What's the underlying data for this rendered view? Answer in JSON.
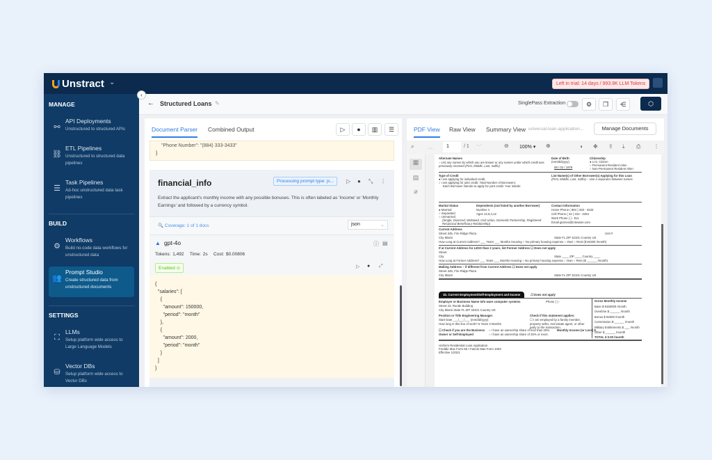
{
  "app": {
    "name": "Unstract",
    "trial": "Left in trial: 14 days / 993.9K LLM Tokens"
  },
  "sidebar": {
    "sections": [
      {
        "title": "MANAGE",
        "items": [
          {
            "label": "API Deployments",
            "desc": "Unstructured to structured APIs",
            "icon": "api-icon"
          },
          {
            "label": "ETL Pipelines",
            "desc": "Unstructured to structured data pipelines",
            "icon": "etl-icon"
          },
          {
            "label": "Task Pipelines",
            "desc": "Ad-hoc unstructured data task pipelines",
            "icon": "task-icon"
          }
        ]
      },
      {
        "title": "BUILD",
        "items": [
          {
            "label": "Workflows",
            "desc": "Build no-code data workflows for unstructured data",
            "icon": "workflow-icon"
          },
          {
            "label": "Prompt Studio",
            "desc": "Create structured data from unstructured documents",
            "icon": "prompt-studio-icon"
          }
        ]
      },
      {
        "title": "SETTINGS",
        "items": [
          {
            "label": "LLMs",
            "desc": "Setup platform wide access to Large Language Models",
            "icon": "llm-icon"
          },
          {
            "label": "Vector DBs",
            "desc": "Setup platform wide access to Vector DBs",
            "icon": "database-icon"
          }
        ]
      }
    ]
  },
  "header": {
    "title": "Structured Loans",
    "singlepass": "SinglePass Extraction"
  },
  "mid": {
    "tabs": [
      "Document Parser",
      "Combined Output"
    ],
    "prev_output": [
      "\"Phone Number\": \"(884) 333-3433\"",
      "}"
    ],
    "prompt": {
      "title": "financial_info",
      "status": "Processing prompt type: js...",
      "text": "Extract the applicant's monthly income with any possible bonuses. This is often labeled as 'Income' or 'Monthly Earnings' and followed by a currency symbol.",
      "coverage": "Coverage: 1 of 1 docs",
      "type": "json"
    },
    "llm": {
      "name": "gpt-4o",
      "tokens": "Tokens: 1,492",
      "time": "Time: 2s",
      "cost": "Cost: $0.00806",
      "enabled": "Enabled"
    },
    "output": [
      "{",
      "  \"salaries\": [",
      "    {",
      "      \"amount\": 150000,",
      "      \"period\": \"month\"",
      "    },",
      "    {",
      "      \"amount\": 2000,",
      "      \"period\": \"month\"",
      "    }",
      "  ]",
      "}"
    ]
  },
  "right": {
    "tabs": [
      "PDF View",
      "Raw View",
      "Summary View"
    ],
    "filename": "universal-loan-application...",
    "manage": "Manage Documents",
    "page": "1",
    "pages": "/ 1",
    "zoom": "100% ▾"
  },
  "pdf": {
    "alt_names": "Alternate Names",
    "alt_desc": "– List any names by which you are known or any names under which credit was previously received (First, Middle, Last, Suffix)",
    "dob": "Date of Birth",
    "dob_fmt": "(mm/dd/yyyy)",
    "dob_val": "08 / 02 / 1979",
    "citizenship": "Citizenship",
    "cit1": "U.S. Citizen",
    "cit2": "Permanent Resident Alien",
    "cit3": "Non-Permanent Resident Alien",
    "type_credit": "Type of Credit",
    "tc1": "I am applying for individual credit.",
    "tc2": "I am applying for joint credit. Total Number of Borrowers:",
    "tc3": "Each Borrower intends to apply for joint credit. Your initials:",
    "other_borrowers": "List Name(s) of Other Borrower(s) Applying for this Loan",
    "other_desc": "(First, Middle, Last, Suffix) – Use a separator between names",
    "marital": "Marital Status",
    "m1": "Married",
    "m2": "Separated",
    "m3": "Unmarried",
    "m_desc": "(Single, Divorced, Widowed, Civil Union, Domestic Partnership, Registered Reciprocal Beneficiary Relationship)",
    "dependents": "Dependents (not listed by another Borrower)",
    "dep_num": "Number  4",
    "dep_ages": "Ages 12,8,4,12",
    "contact": "Contact Information",
    "home": "Home Phone  ( 884 ) 333 - 3433",
    "cell": "Cell Phone  ( 22 ) 222 - 3454",
    "work": "Work Phone  (     )       -          Ext.",
    "email": "Email  gtomes@intoware.com",
    "cur_addr": "Current Address",
    "street1": "Street  345, Fire Ridge Plaza",
    "city1": "City  Miami",
    "state1": "State  FL    ZIP  32101    Country  US",
    "unit": "Unit #",
    "howlong": "How Long at Current Address? ___ Years ___ Months  Housing  ○ No primary housing expense  ○ Own  ○ Rent ($  84300  /month)",
    "former": "If at Current Address for LESS than 2 years, list Former Address   ☐ Does not apply",
    "street_e": "Street",
    "city_e": "City",
    "state_e": "State ____ ZIP ____ Country ____",
    "howlong2": "How Long at Former Address? ___ Years ___ Months  Housing  ○ No primary housing expense  ○ Own  ○ Rent ($ ______ /month)",
    "mailing": "Mailing Address – if different from Current Address   ☐ Does not apply",
    "emp_title": "1b. Current Employment/Self-Employment and Income",
    "emp_dna": "☐ Does not apply",
    "employer": "Employer or Business Name  Info ware computer systems",
    "phone": "Phone  (     )      -",
    "emp_street": "Street  23, Ronde Building",
    "emp_city": "City  Miami     State  FL    ZIP  33101    Country  US",
    "position": "Position or Title  Engineering Manager",
    "start": "Start Date  ___/___/___ (mm/dd/yyyy)",
    "howlong_work": "How long in this line of work?  5  Years  3  Months",
    "check": "Check if this statement applies:",
    "check_desc": "☐ I am employed by a family member, property seller, real estate agent, or other party to the transaction.",
    "owner": "☐ Check if you are the Business Owner or Self-Employed",
    "own1": "○ I have an ownership share of less than 25%.",
    "own2": "○ I have an ownership share of 25% or more.",
    "monthly": "Monthly Income (or Loss)  $",
    "gross": "Gross Monthly Income",
    "g": [
      "Base  $  9150000 /month",
      "Overtime  $ ______ /month",
      "Bonus  $  82000 /month",
      "Commission $ ______ /month",
      "Military Entitlements $ ___ /month",
      "Other  $ ______ /month",
      "TOTAL $  0.00 /month"
    ],
    "footer": [
      "Uniform Residential Loan Application",
      "Freddie Mac Form 65 • Fannie Mae Form 1003",
      "Effective 1/2021"
    ]
  }
}
